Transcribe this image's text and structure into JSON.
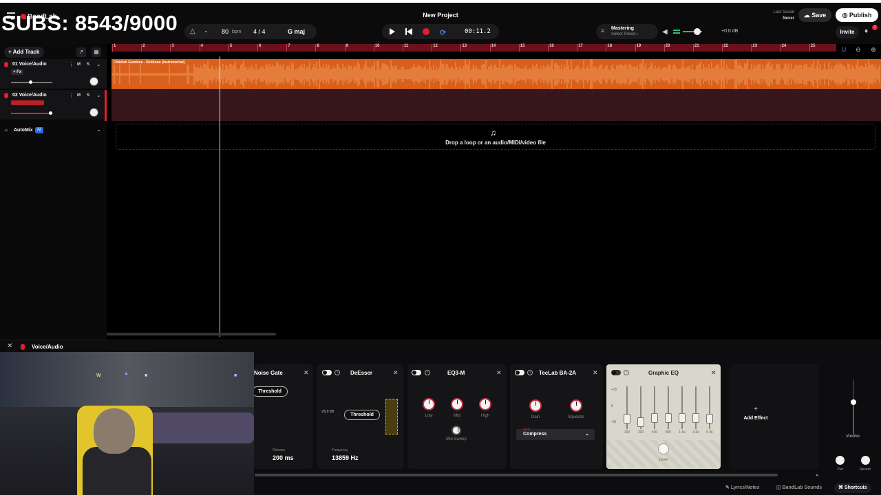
{
  "overlay": {
    "subs": "SUBS: 8543/9000"
  },
  "app": {
    "brand": "BandLab",
    "project_title": "New Project"
  },
  "toolbar": {
    "tempo": "80",
    "tempo_unit": "bpm",
    "time_sig": "4 / 4",
    "key": "G maj",
    "time": "00:11.2",
    "mastering_label": "Mastering",
    "mastering_preset": "Select Preset ›",
    "master_gain": "+0.0 dB",
    "last_saved_label": "Last Saved",
    "last_saved_value": "Never",
    "save": "Save",
    "publish": "Publish",
    "invite": "Invite",
    "notif_count": "1"
  },
  "tracks": {
    "add_track": "Add Track",
    "items": [
      {
        "name": "01  Voice/Audio",
        "fx": "+ Fx",
        "m": "M",
        "s": "S",
        "clip": "Childish Gambino - Redbone (Instrumental)"
      },
      {
        "name": "02  Voice/Audio",
        "fx": "",
        "m": "M",
        "s": "S"
      }
    ],
    "automix": "AutoMix",
    "automix_badge": "AI"
  },
  "ruler": {
    "ticks": [
      "1",
      "2",
      "3",
      "4",
      "5",
      "6",
      "7",
      "8",
      "9",
      "10",
      "11",
      "12",
      "13",
      "14",
      "15",
      "16",
      "17",
      "18",
      "19",
      "20",
      "21",
      "22",
      "23",
      "24",
      "25"
    ]
  },
  "drop_zone": {
    "text": "Drop a loop or an audio/MIDI/video file"
  },
  "fx_panel": {
    "track_label": "Voice/Audio",
    "noise_gate": {
      "title": "Noise Gate",
      "threshold": "Threshold",
      "release_label": "Release",
      "release_value": "200 ms"
    },
    "deesser": {
      "title": "DeEsser",
      "threshold": "Threshold",
      "db": "-25.0 dB",
      "freq_label": "Frequency",
      "freq_value": "13859 Hz"
    },
    "eq3": {
      "title": "EQ3-M",
      "low": "Low",
      "mid": "Mid",
      "high": "High",
      "mid_sweep": "Mid Sweep"
    },
    "teclab": {
      "title": "TecLab BA-2A",
      "gain": "Gain",
      "squeeze": "Squeeze",
      "mode_label": "Mode",
      "mode_value": "Compress"
    },
    "geq": {
      "title": "Graphic EQ",
      "scale": [
        "+15",
        "0",
        "-15"
      ],
      "bands": [
        "100",
        "200",
        "400",
        "800",
        "1.6k",
        "3.2k",
        "6.4k"
      ],
      "level_label": "Level"
    },
    "add_effect": "Add Effect",
    "volume": "Volume",
    "pan": "Pan",
    "reverb": "Reverb"
  },
  "footer": {
    "lyrics": "Lyrics/Notes",
    "sounds": "BandLab Sounds",
    "shortcuts": "Shortcuts"
  },
  "colors": {
    "accent_red": "#e0202e",
    "clip_orange": "#d8601c",
    "loop_blue": "#3a7fe0"
  }
}
